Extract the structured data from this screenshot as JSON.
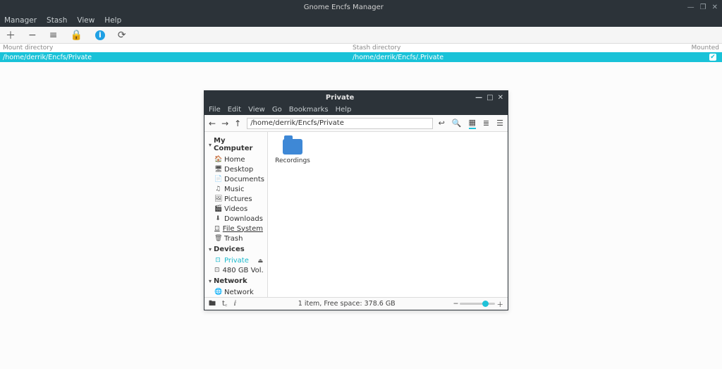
{
  "encfs": {
    "title": "Gnome Encfs Manager",
    "menu": [
      "Manager",
      "Stash",
      "View",
      "Help"
    ],
    "columns": {
      "mount": "Mount directory",
      "stash": "Stash directory",
      "mounted": "Mounted"
    },
    "row": {
      "mount": "/home/derrik/Encfs/Private",
      "stash": "/home/derrik/Encfs/.Private",
      "checked": "✔"
    }
  },
  "fm": {
    "title": "Private",
    "menu": [
      "File",
      "Edit",
      "View",
      "Go",
      "Bookmarks",
      "Help"
    ],
    "path": "/home/derrik/Encfs/Private",
    "sidebar": {
      "sections": {
        "computer": "My Computer",
        "devices": "Devices",
        "network": "Network"
      },
      "computer_items": [
        {
          "icon": "🏠",
          "label": "Home"
        },
        {
          "icon": "🖥",
          "label": "Desktop"
        },
        {
          "icon": "📄",
          "label": "Documents"
        },
        {
          "icon": "♫",
          "label": "Music"
        },
        {
          "icon": "🖼",
          "label": "Pictures"
        },
        {
          "icon": "🎬",
          "label": "Videos"
        },
        {
          "icon": "⬇",
          "label": "Downloads"
        },
        {
          "icon": "⊡",
          "label": "File System"
        },
        {
          "icon": "🗑",
          "label": "Trash"
        }
      ],
      "devices_items": [
        {
          "icon": "⊡",
          "label": "Private",
          "active": true,
          "eject": true
        },
        {
          "icon": "⊡",
          "label": "480 GB Vol…"
        }
      ],
      "network_items": [
        {
          "icon": "🌐",
          "label": "Network"
        }
      ]
    },
    "folder": {
      "label": "Recordings"
    },
    "status": "1 item, Free space: 378.6 GB"
  }
}
